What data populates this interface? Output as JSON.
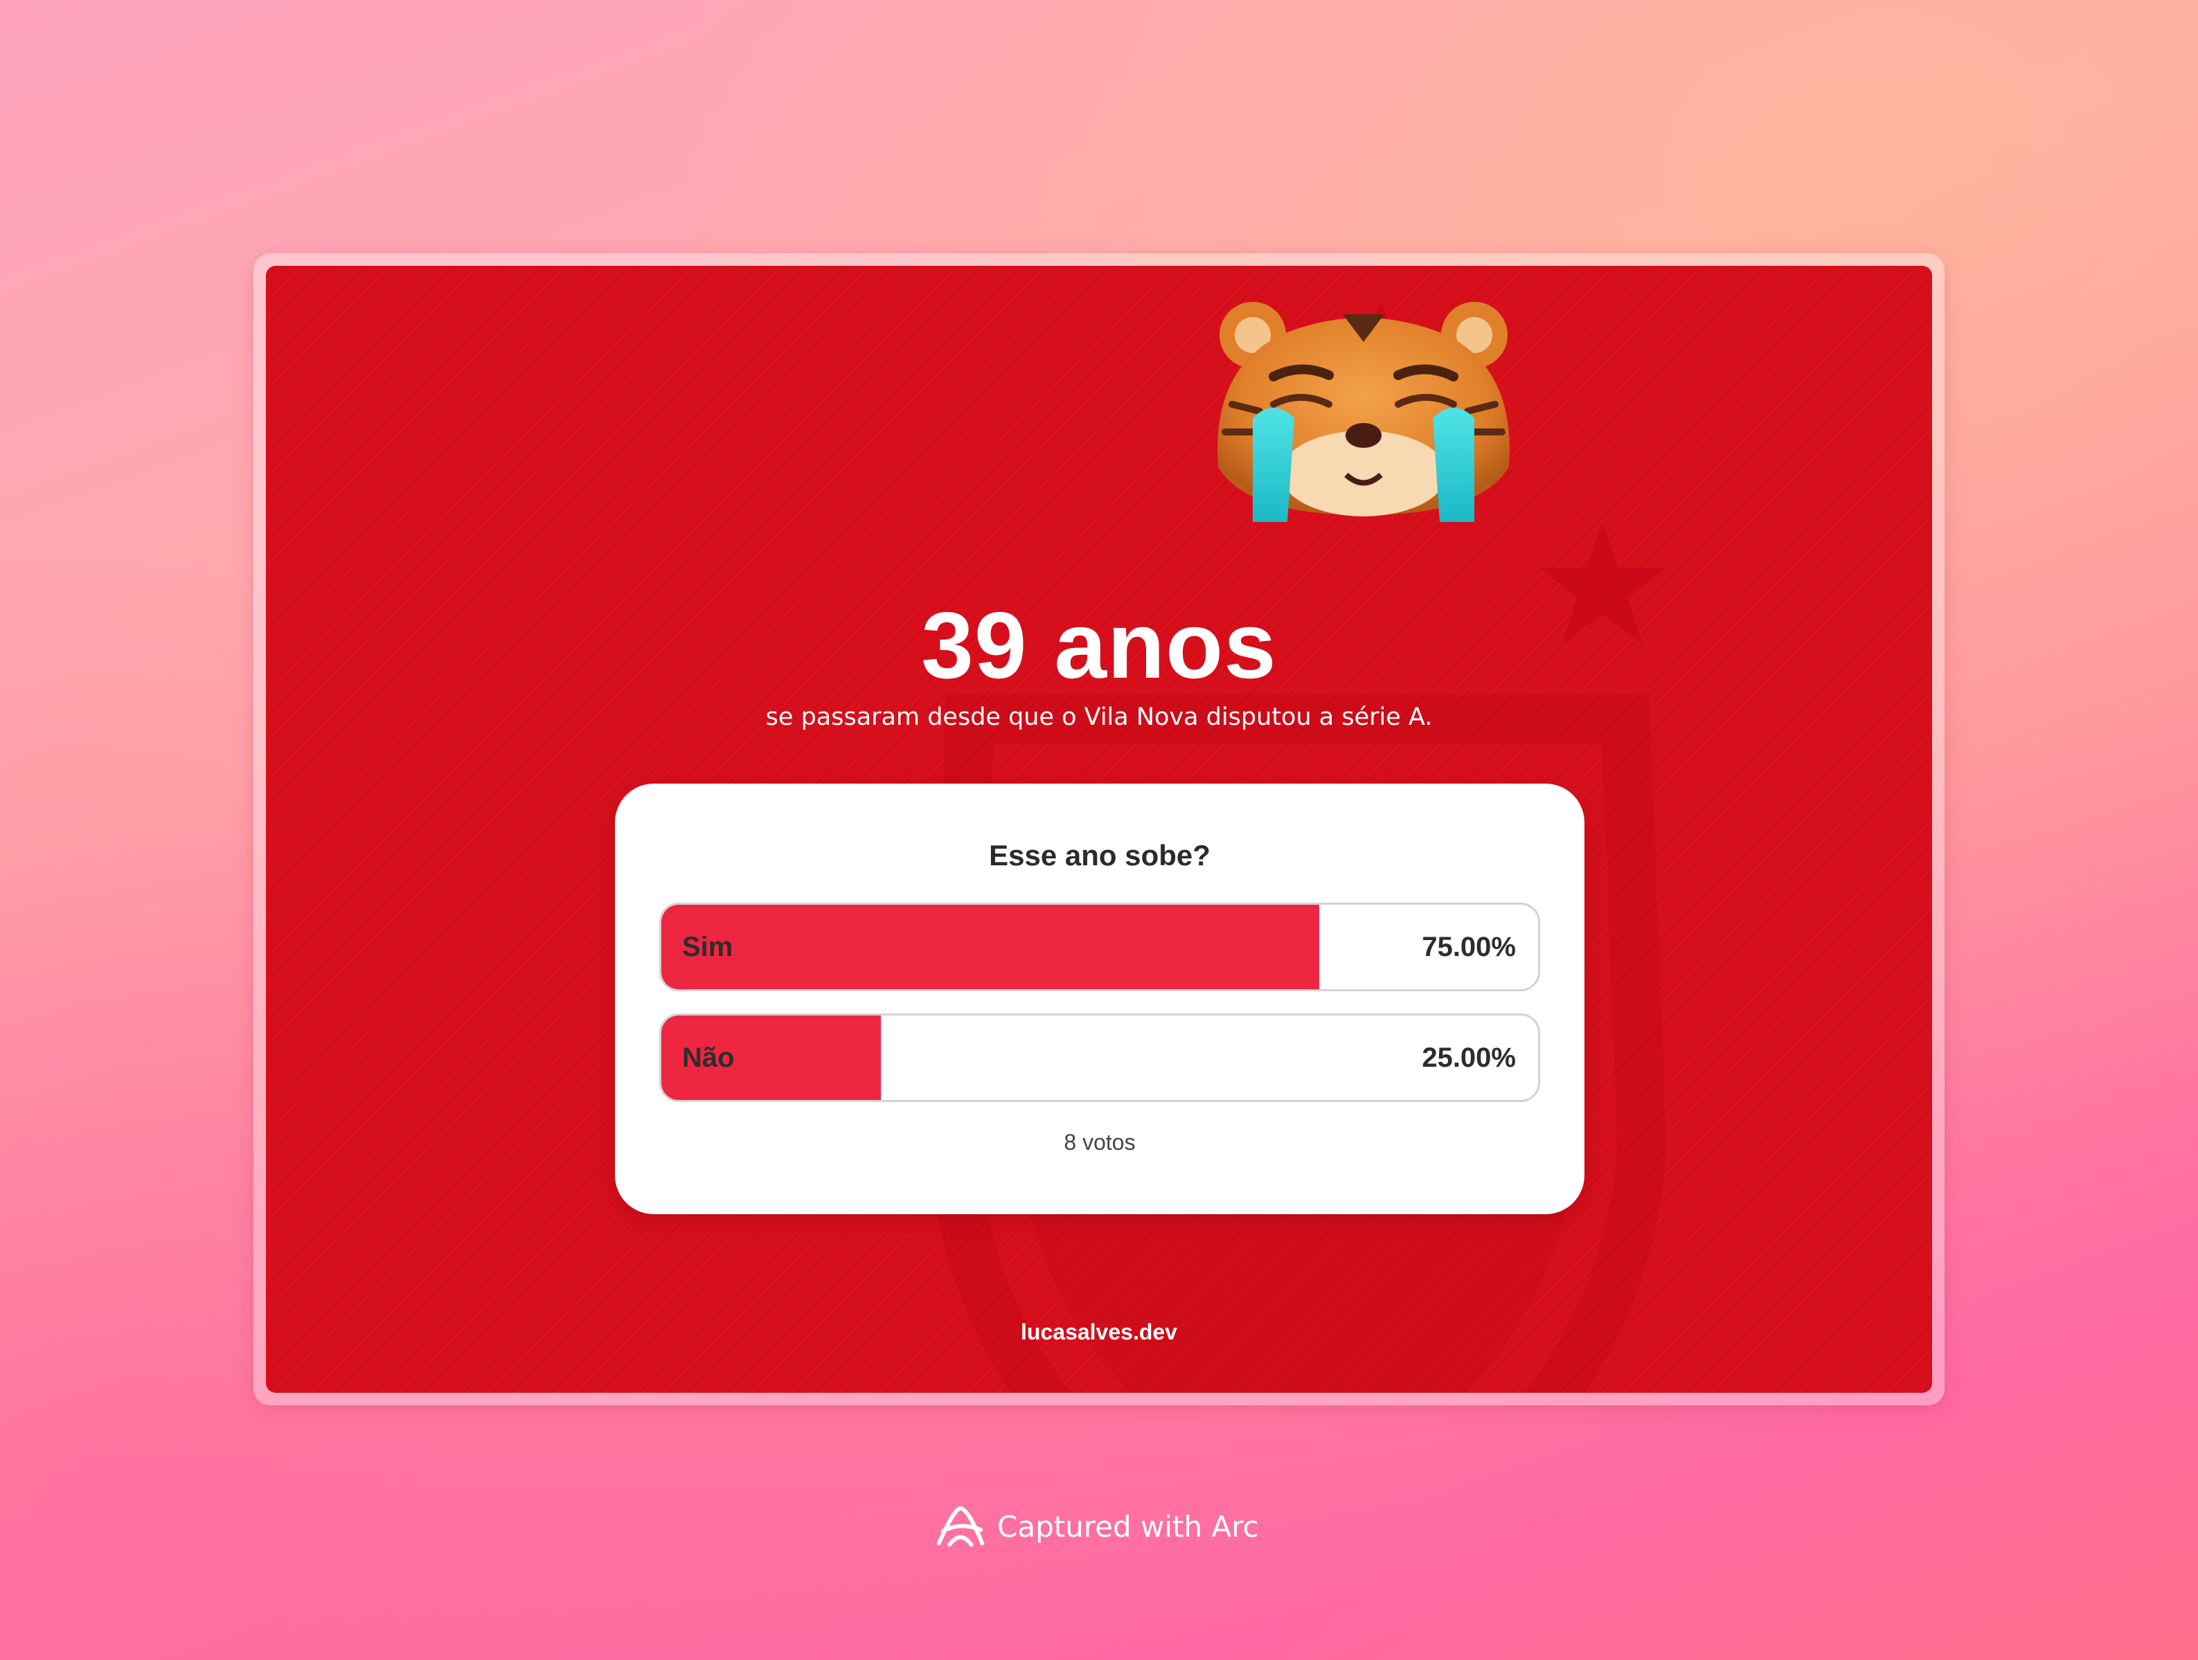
{
  "card": {
    "headline": "39 anos",
    "subtitle": "se passaram desde que o Vila Nova disputou a série A.",
    "footer_link": "lucasalves.dev"
  },
  "poll": {
    "question": "Esse ano sobe?",
    "options": [
      {
        "label": "Sim",
        "percent_text": "75.00%",
        "percent": 75
      },
      {
        "label": "Não",
        "percent_text": "25.00%",
        "percent": 25
      }
    ],
    "votes_text": "8 votos"
  },
  "colors": {
    "page_background": "#d90f1c",
    "bar_fill": "#ee2642"
  },
  "icons": {
    "mascot": "crying-tiger-icon",
    "arc_logo": "arc-logo-icon"
  },
  "capture": {
    "text": "Captured with Arc"
  }
}
